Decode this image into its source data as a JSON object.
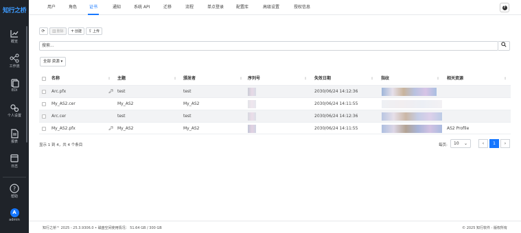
{
  "sidebar": {
    "brand": "知行之桥",
    "items": [
      {
        "label": "概览",
        "icon": "line-chart-icon"
      },
      {
        "label": "工作流",
        "icon": "workflow-icon"
      },
      {
        "label": "EDI",
        "icon": "edi-documents-icon"
      },
      {
        "label": "个人设置",
        "icon": "gear-icon"
      },
      {
        "label": "报表",
        "icon": "report-icon"
      },
      {
        "label": "日志",
        "icon": "log-icon"
      },
      {
        "label": "帮助",
        "icon": "help-icon"
      }
    ],
    "user": {
      "initial": "A",
      "name": "admin"
    }
  },
  "topbar": {
    "tabs": [
      "用户",
      "角色",
      "证书",
      "通知",
      "系统 API",
      "迁移",
      "流程",
      "单点登录",
      "配置库",
      "高级设置",
      "授权信息"
    ],
    "active_tab": "证书",
    "help_label": "?"
  },
  "toolbar": {
    "refresh_glyph": "⟳",
    "delete_label": "删除",
    "create_label": "创建",
    "upload_label": "上传"
  },
  "search": {
    "placeholder": "搜索..."
  },
  "filter": {
    "label": "全部 资源 ▾"
  },
  "table": {
    "columns": [
      "名称",
      "主题",
      "颁发者",
      "序列号",
      "失效日期",
      "指纹",
      "相关资源"
    ],
    "rows": [
      {
        "name": "Arc.pfx",
        "has_key": true,
        "subject": "test",
        "issuer": "test",
        "expires": "2030/06/24 14:12:36",
        "resource": ""
      },
      {
        "name": "My_AS2.cer",
        "has_key": false,
        "subject": "My_AS2",
        "issuer": "My_AS2",
        "expires": "2030/06/24 14:11:55",
        "resource": ""
      },
      {
        "name": "Arc.cer",
        "has_key": false,
        "subject": "test",
        "issuer": "test",
        "expires": "2030/06/24 14:12:36",
        "resource": ""
      },
      {
        "name": "My_AS2.pfx",
        "has_key": true,
        "subject": "My_AS2",
        "issuer": "My_AS2",
        "expires": "2030/06/24 14:11:55",
        "resource": "AS2 Profile"
      }
    ]
  },
  "summary": "显示 1 到 4，共 4 个条目",
  "pager": {
    "page_size_label": "每页:",
    "page_size": "10",
    "current_page": "1",
    "prev": "‹",
    "next": "›"
  },
  "footer": {
    "left": "知行之桥™ 2025 - 25.3.9306.0  •  磁盘空间使用情况： 51.64 GB / 300 GB",
    "right": "© 2025 知行软件 - 版权所有"
  },
  "colors": {
    "accent": "#1677ff",
    "sidebar_bg": "#1f2329",
    "row_shade": "#f2f3f5"
  }
}
